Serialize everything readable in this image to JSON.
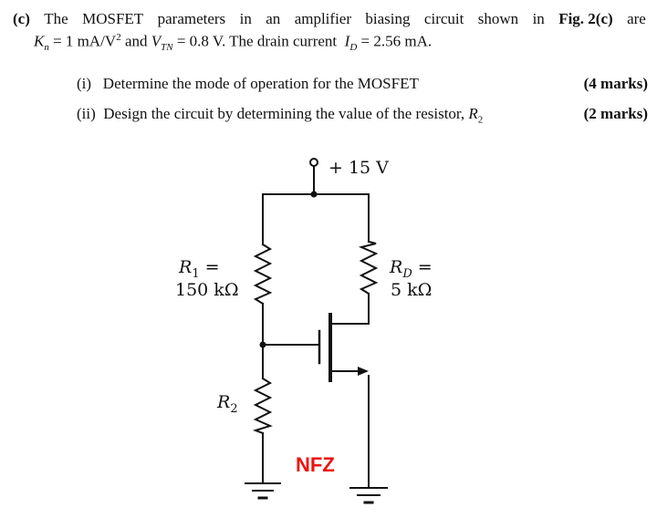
{
  "question": {
    "label": "(c)",
    "intro_words": [
      "The",
      "MOSFET",
      "parameters",
      "in",
      "an",
      "amplifier",
      "biasing",
      "circuit",
      "shown",
      "in"
    ],
    "fig_ref": "Fig. 2(c)",
    "intro_end": "are",
    "params": {
      "kn_symbol": "K",
      "kn_sub": "n",
      "kn_value": "= 1 mA/V",
      "kn_unit_sup": "2",
      "and": "and",
      "vtn_symbol": "V",
      "vtn_sub": "TN",
      "vtn_value": "= 0.8 V. The drain current",
      "id_symbol": "I",
      "id_sub": "D",
      "id_value": "= 2.56 mA."
    },
    "sub_questions": [
      {
        "num": "(i)",
        "text": "Determine the mode of operation for the MOSFET",
        "marks": "(4 marks)"
      },
      {
        "num": "(ii)",
        "text": "Design the circuit by determining the value of the resistor,",
        "symbol": "R",
        "symbol_sub": "2",
        "marks": "(2 marks)"
      }
    ]
  },
  "circuit": {
    "supply_label": "+ 15 V",
    "r1_label_line1": "R",
    "r1_sub": "1",
    "r1_eq": " =",
    "r1_value": "150 kΩ",
    "rd_label_line1": "R",
    "rd_sub": "D",
    "rd_eq": " =",
    "rd_value": "5 kΩ",
    "r2_label": "R",
    "r2_sub": "2",
    "watermark": "NFZ",
    "watermark_color": "#ee1111"
  }
}
